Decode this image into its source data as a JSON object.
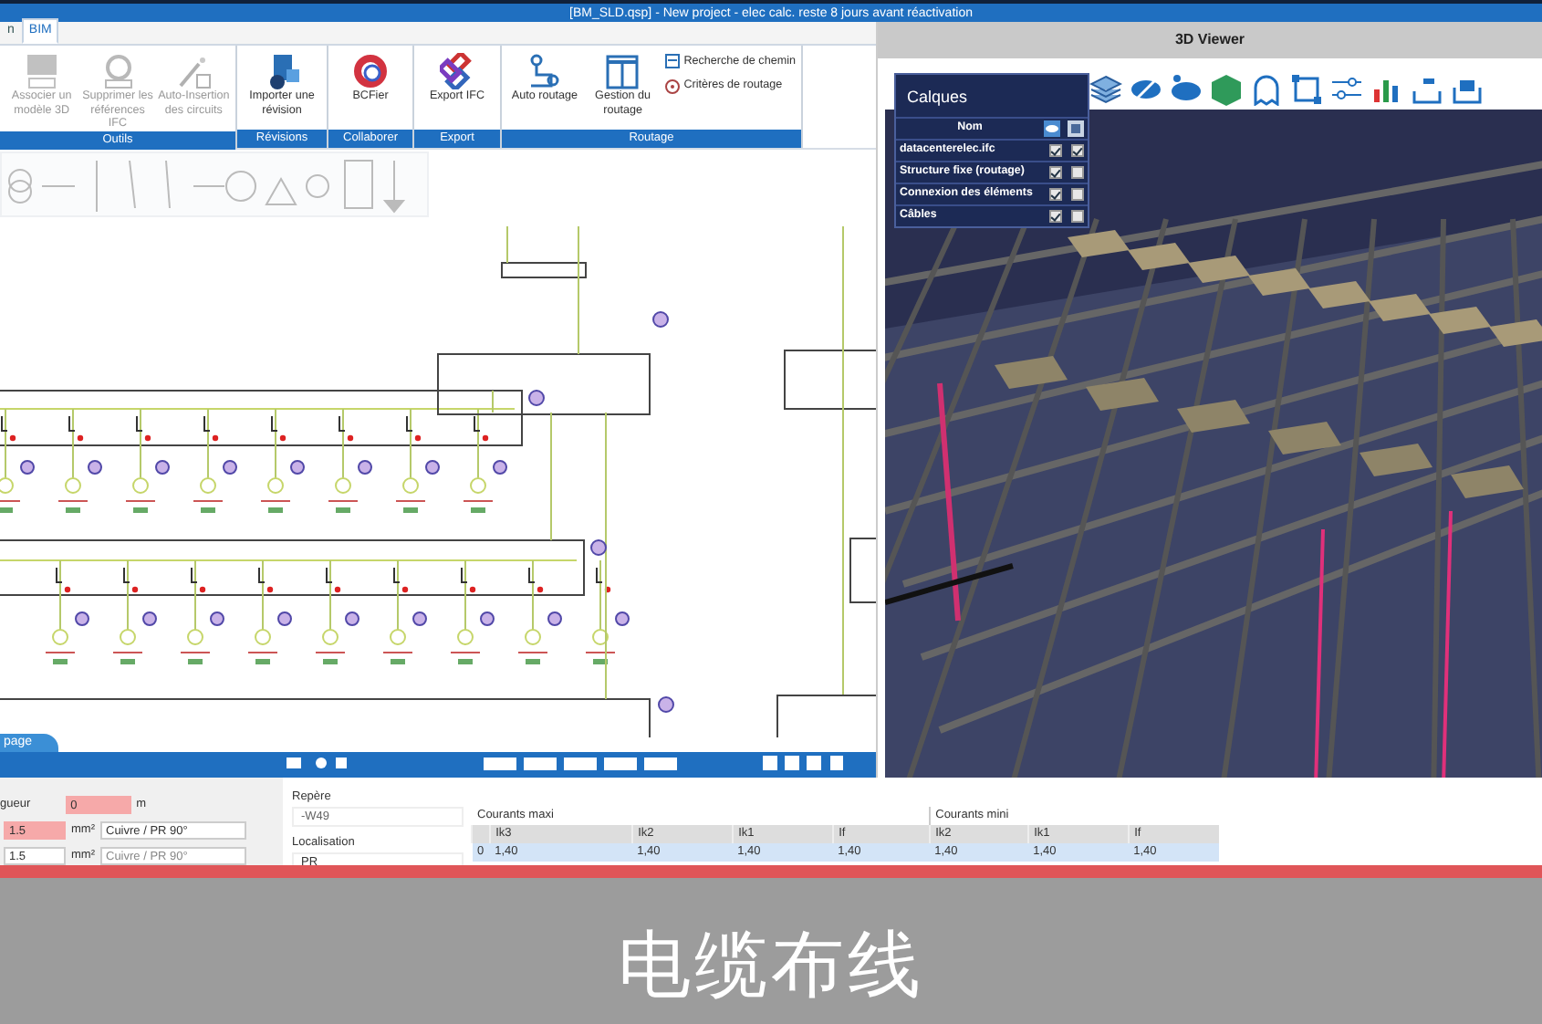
{
  "window": {
    "title": "[BM_SLD.qsp] - New project - elec calc. reste 8 jours avant réactivation"
  },
  "ribbon_tabs": [
    {
      "label": "n",
      "selected": false
    },
    {
      "label": "BIM",
      "selected": true
    }
  ],
  "ribbon_groups": [
    {
      "label": "Outils",
      "disabled": true,
      "buttons": [
        {
          "label": "Associer un modèle 3D"
        },
        {
          "label": "Supprimer les références IFC"
        },
        {
          "label": "Auto-Insertion des circuits"
        }
      ]
    },
    {
      "label": "Révisions",
      "disabled": false,
      "buttons": [
        {
          "label": "Importer une révision"
        }
      ]
    },
    {
      "label": "Collaborer",
      "disabled": false,
      "buttons": [
        {
          "label": "BCFier"
        }
      ]
    },
    {
      "label": "Export",
      "disabled": false,
      "buttons": [
        {
          "label": "Export IFC"
        }
      ]
    },
    {
      "label": "Routage",
      "disabled": false,
      "buttons": [
        {
          "label": "Auto routage"
        },
        {
          "label": "Gestion du routage"
        }
      ],
      "small_buttons": [
        {
          "label": "Recherche de chemin"
        },
        {
          "label": "Critères de routage"
        }
      ]
    }
  ],
  "page_tab": {
    "label": "page"
  },
  "viewer": {
    "title": "3D Viewer",
    "layers_title": "Calques",
    "column": "Nom",
    "layers": [
      {
        "name": "datacenterelec.ifc",
        "visible": true,
        "active": true
      },
      {
        "name": "Structure fixe (routage)",
        "visible": true,
        "active": false
      },
      {
        "name": "Connexion des éléments",
        "visible": true,
        "active": false
      },
      {
        "name": "Câbles",
        "visible": true,
        "active": false
      }
    ]
  },
  "cable_form": {
    "length_label": "gueur",
    "length_value": "0",
    "length_unit": "m",
    "sections": [
      {
        "value": "1.5",
        "unit": "mm²",
        "material": "Cuivre / PR 90°",
        "highlighted": true
      },
      {
        "value": "1.5",
        "unit": "mm²",
        "material": "Cuivre / PR 90°",
        "highlighted": false
      }
    ]
  },
  "identity": {
    "repere_label": "Repère",
    "repere_value": "-W49",
    "localisation_label": "Localisation",
    "localisation_value": "PR"
  },
  "currents": {
    "max_title": "Courants maxi",
    "min_title": "Courants mini",
    "max_columns": [
      "Ik3",
      "Ik2",
      "Ik1",
      "If"
    ],
    "min_columns": [
      "Ik2",
      "Ik1",
      "If"
    ],
    "rows": [
      {
        "index": "0",
        "selected": true,
        "values": [
          "1,40",
          "1,40",
          "1,40",
          "1,40",
          "1,40",
          "1,40",
          "1,40"
        ]
      }
    ]
  },
  "subtitle": "电缆布线"
}
